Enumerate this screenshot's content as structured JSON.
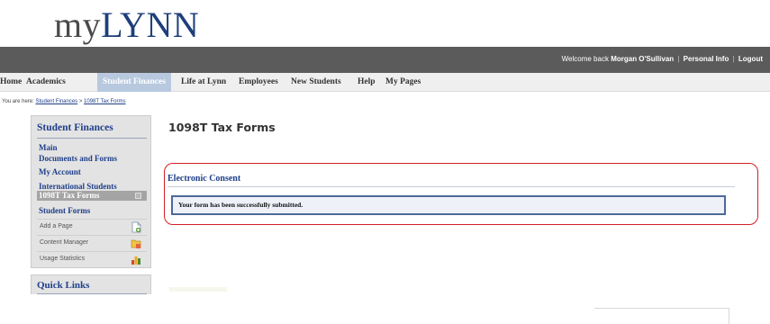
{
  "brand": {
    "prefix": "my",
    "name": "LYNN"
  },
  "topbar": {
    "welcome_prefix": "Welcome back",
    "user_name": "Morgan O'Sullivan",
    "personal_info": "Personal Info",
    "separator": "|",
    "logout": "Logout"
  },
  "nav": {
    "items": [
      {
        "label": "Home",
        "active": false
      },
      {
        "label": "Academics",
        "active": false
      },
      {
        "label": "Student Finances",
        "active": true
      },
      {
        "label": "Life at Lynn",
        "active": false
      },
      {
        "label": "Employees",
        "active": false
      },
      {
        "label": "New Students",
        "active": false
      },
      {
        "label": "Help",
        "active": false
      },
      {
        "label": "My Pages",
        "active": false
      }
    ]
  },
  "breadcrumb": {
    "prefix": "You are here:",
    "items": [
      "Student Finances",
      "1098T Tax Forms"
    ],
    "separator": ">"
  },
  "sidebar": {
    "title": "Student Finances",
    "links": [
      "Main",
      "Documents and Forms",
      "My Account",
      "International Students"
    ],
    "selected": "1098T Tax Forms",
    "after_links": [
      "Student Forms"
    ],
    "tools": [
      {
        "label": "Add a Page",
        "icon": "add-page-icon"
      },
      {
        "label": "Content Manager",
        "icon": "content-manager-icon"
      },
      {
        "label": "Usage Statistics",
        "icon": "usage-statistics-icon"
      }
    ]
  },
  "quick_links": {
    "title": "Quick Links"
  },
  "main": {
    "title": "1098T Tax Forms",
    "consent_title": "Electronic Consent",
    "message": "Your form has been successfully submitted."
  },
  "colors": {
    "topbar": "#5b5b5b",
    "nav_active": "#b8c9df",
    "link_blue": "#1f3f8a",
    "highlight_red": "#d21f26",
    "message_border": "#4c6a9a"
  }
}
